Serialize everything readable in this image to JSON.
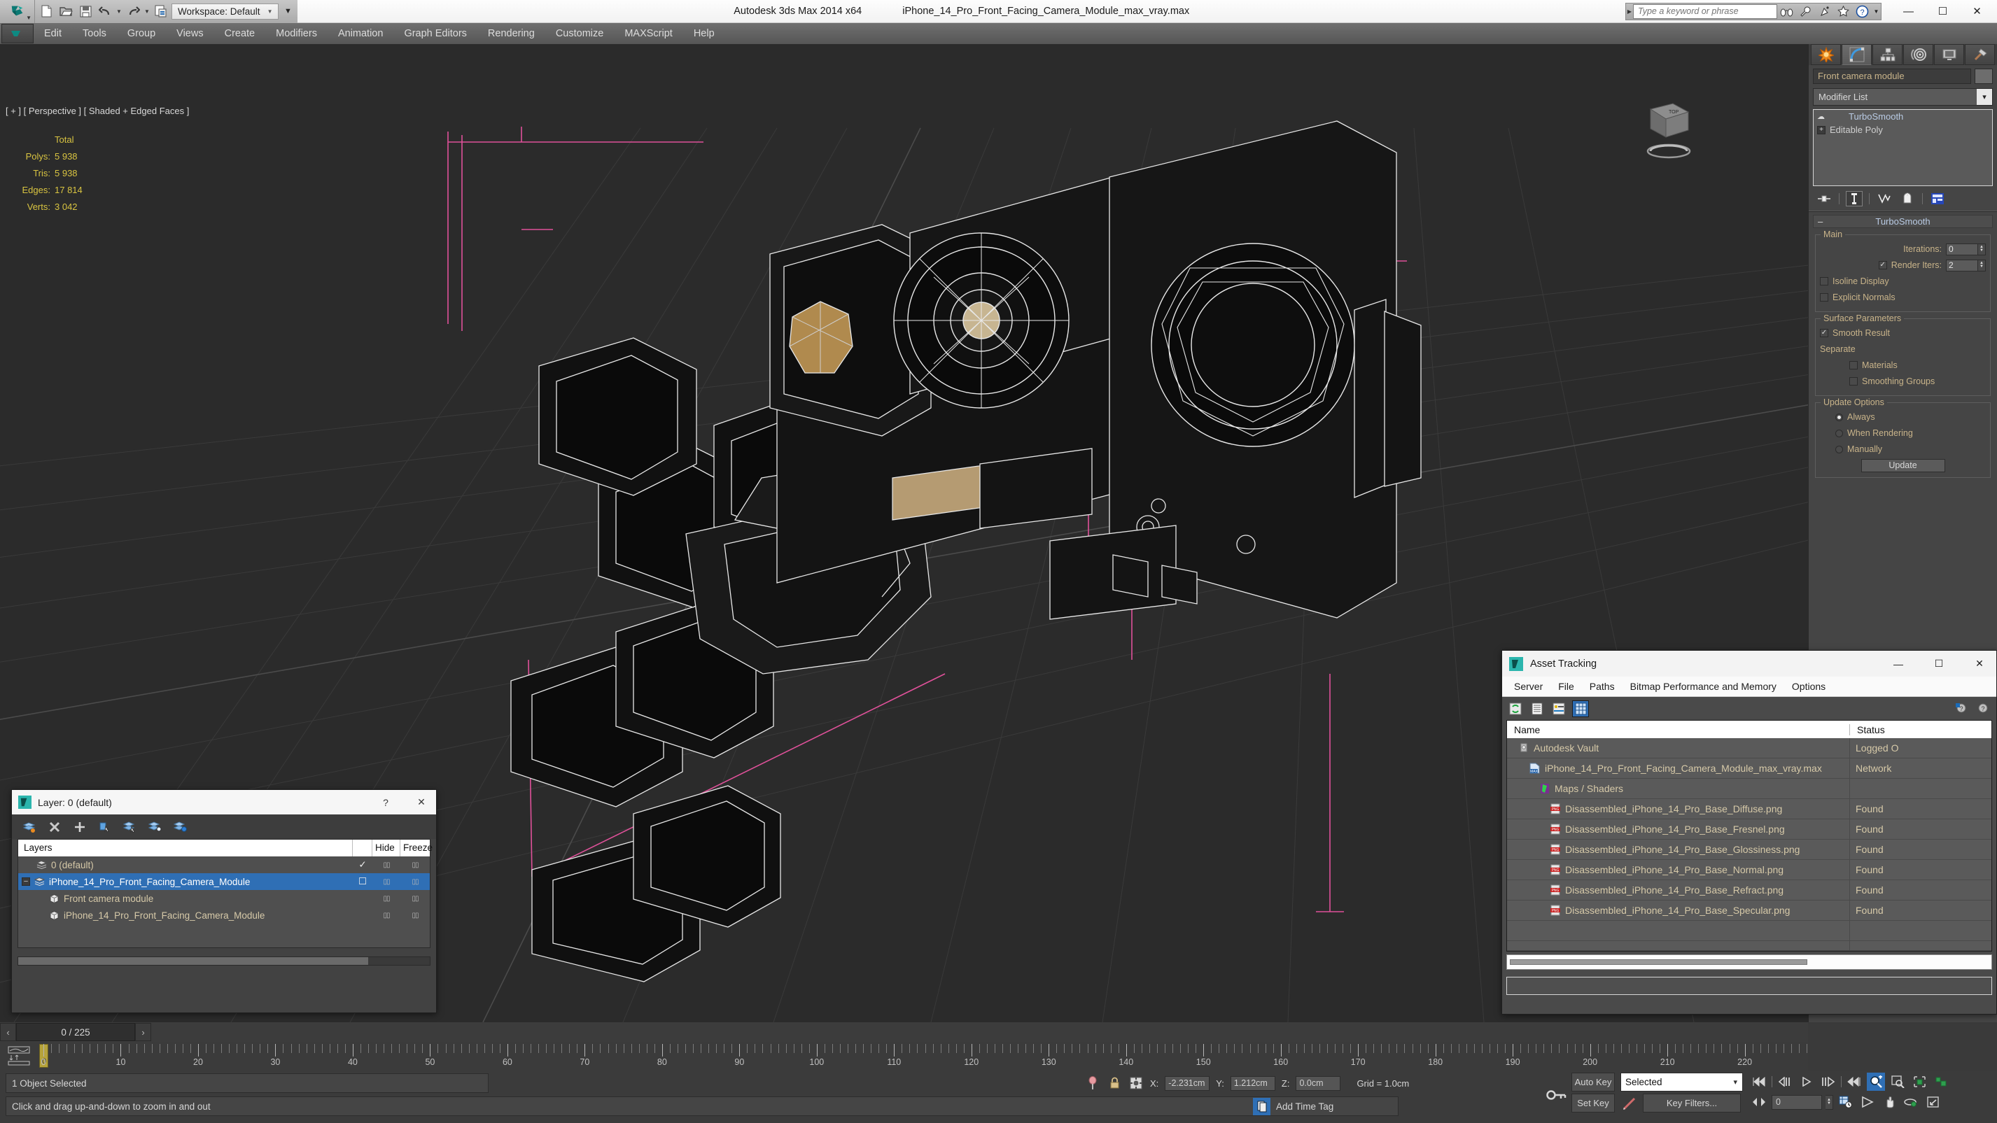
{
  "titlebar": {
    "workspace": "Workspace: Default",
    "app_title": "Autodesk 3ds Max  2014 x64",
    "file_title": "iPhone_14_Pro_Front_Facing_Camera_Module_max_vray.max",
    "search_placeholder": "Type a keyword or phrase",
    "quick_icons": [
      "new-file-icon",
      "open-file-icon",
      "save-icon",
      "undo-icon",
      "undo-dropdown-icon",
      "redo-icon",
      "redo-dropdown-icon",
      "set-project-folder-icon"
    ],
    "search_icons": [
      "binoculars-icon",
      "wrench-icon",
      "satellite-icon",
      "star-icon",
      "help-icon",
      "help-dropdown-icon"
    ],
    "window_buttons": [
      "minimize",
      "restore",
      "close"
    ]
  },
  "menubar": {
    "items": [
      "Edit",
      "Tools",
      "Group",
      "Views",
      "Create",
      "Modifiers",
      "Animation",
      "Graph Editors",
      "Rendering",
      "Customize",
      "MAXScript",
      "Help"
    ]
  },
  "viewport": {
    "label": "[ + ] [ Perspective ] [ Shaded + Edged Faces ]",
    "stats_header": "Total",
    "stats": [
      {
        "label": "Polys:",
        "value": "5 938"
      },
      {
        "label": "Tris:",
        "value": "5 938"
      },
      {
        "label": "Edges:",
        "value": "17 814"
      },
      {
        "label": "Verts:",
        "value": "3 042"
      }
    ],
    "stats_color": "#d9c441",
    "bg_color": "#2b2b2b",
    "viewcube_label": "TOP"
  },
  "command_panel": {
    "tabs": [
      "create-tab",
      "modify-tab",
      "hierarchy-tab",
      "motion-tab",
      "display-tab",
      "utilities-tab"
    ],
    "active_tab_index": 1,
    "object_name": "Front camera module",
    "modifier_list_label": "Modifier List",
    "stack": [
      {
        "label": "TurboSmooth",
        "selected": true
      },
      {
        "label": "Editable Poly",
        "selected": false
      }
    ],
    "stack_buttons": [
      "pin-stack-icon",
      "show-end-result-icon",
      "make-unique-icon",
      "remove-modifier-icon",
      "configure-modifier-sets-icon"
    ],
    "rollout": {
      "title": "TurboSmooth",
      "groups": [
        {
          "title": "Main",
          "fields": [
            {
              "type": "spinner",
              "label": "Iterations:",
              "value": "0",
              "checkbox": null
            },
            {
              "type": "spinner",
              "label": "Render Iters:",
              "value": "2",
              "checkbox": true
            },
            {
              "type": "checkbox",
              "label": "Isoline Display",
              "checked": false
            },
            {
              "type": "checkbox",
              "label": "Explicit Normals",
              "checked": false
            }
          ]
        },
        {
          "title": "Surface Parameters",
          "fields": [
            {
              "type": "checkbox",
              "label": "Smooth Result",
              "checked": true
            },
            {
              "type": "text",
              "label": "Separate"
            },
            {
              "type": "checkbox",
              "label": "Materials",
              "checked": false,
              "indent": true
            },
            {
              "type": "checkbox",
              "label": "Smoothing Groups",
              "checked": false,
              "indent": true
            }
          ]
        },
        {
          "title": "Update Options",
          "fields": [
            {
              "type": "radio",
              "label": "Always",
              "checked": true
            },
            {
              "type": "radio",
              "label": "When Rendering",
              "checked": false
            },
            {
              "type": "radio",
              "label": "Manually",
              "checked": false
            },
            {
              "type": "button",
              "label": "Update"
            }
          ]
        }
      ]
    }
  },
  "asset_tracking": {
    "title": "Asset Tracking",
    "menu": [
      "Server",
      "File",
      "Paths",
      "Bitmap Performance and Memory",
      "Options"
    ],
    "toolbar_icons": [
      "refresh-icon",
      "list-view-icon",
      "details-view-icon",
      "grid-view-icon"
    ],
    "toolbar_right_icons": [
      "help-add-icon",
      "help-icon"
    ],
    "columns": [
      "Name",
      "Status"
    ],
    "rows": [
      {
        "name": "Autodesk Vault",
        "status": "Logged O",
        "icon": "vault-icon",
        "indent": 0
      },
      {
        "name": "iPhone_14_Pro_Front_Facing_Camera_Module_max_vray.max",
        "status": "Network ",
        "icon": "max-file-icon",
        "indent": 1
      },
      {
        "name": "Maps / Shaders",
        "status": "",
        "icon": "maps-icon",
        "indent": 2
      },
      {
        "name": "Disassembled_iPhone_14_Pro_Base_Diffuse.png",
        "status": "Found",
        "icon": "png-icon",
        "indent": 3
      },
      {
        "name": "Disassembled_iPhone_14_Pro_Base_Fresnel.png",
        "status": "Found",
        "icon": "png-icon",
        "indent": 3
      },
      {
        "name": "Disassembled_iPhone_14_Pro_Base_Glossiness.png",
        "status": "Found",
        "icon": "png-icon",
        "indent": 3
      },
      {
        "name": "Disassembled_iPhone_14_Pro_Base_Normal.png",
        "status": "Found",
        "icon": "png-icon",
        "indent": 3
      },
      {
        "name": "Disassembled_iPhone_14_Pro_Base_Refract.png",
        "status": "Found",
        "icon": "png-icon",
        "indent": 3
      },
      {
        "name": "Disassembled_iPhone_14_Pro_Base_Specular.png",
        "status": "Found",
        "icon": "png-icon",
        "indent": 3
      },
      {
        "name": "",
        "status": "",
        "icon": "",
        "indent": 0
      },
      {
        "name": "",
        "status": "",
        "icon": "",
        "indent": 0
      }
    ]
  },
  "layer_dialog": {
    "title": "Layer: 0 (default)",
    "toolbar_icons": [
      "create-new-layer-icon",
      "delete-layer-icon",
      "add-selection-icon",
      "select-objects-icon",
      "select-highlighted-icon",
      "set-current-layer-icon",
      "layer-properties-icon"
    ],
    "columns": [
      "Layers",
      "",
      "Hide",
      "Freeze"
    ],
    "rows": [
      {
        "name": "0 (default)",
        "current": "✓",
        "hide": "",
        "freeze": "",
        "selected": false,
        "expander": "",
        "icon": "layer-icon",
        "indent": 1
      },
      {
        "name": "iPhone_14_Pro_Front_Facing_Camera_Module",
        "current": "box",
        "hide": "",
        "freeze": "",
        "selected": true,
        "expander": "-",
        "icon": "layer-icon",
        "indent": 0
      },
      {
        "name": "Front camera module",
        "current": "",
        "hide": "",
        "freeze": "",
        "selected": false,
        "expander": "",
        "icon": "object-icon",
        "indent": 2
      },
      {
        "name": "iPhone_14_Pro_Front_Facing_Camera_Module",
        "current": "",
        "hide": "",
        "freeze": "",
        "selected": false,
        "expander": "",
        "icon": "object-icon",
        "indent": 2
      }
    ]
  },
  "timeline": {
    "current_frame_label": "0 / 225",
    "prev_icon": "‹",
    "next_icon": "›",
    "ticks": [
      0,
      10,
      20,
      30,
      40,
      50,
      60,
      70,
      80,
      90,
      100,
      110,
      120,
      130,
      140,
      150,
      160,
      170,
      180,
      190,
      200,
      210,
      220
    ],
    "playhead_frame": 0,
    "total_frames": 225
  },
  "statusbar": {
    "selection_text": "1 Object Selected",
    "prompt_text": "Click and drag up-and-down to zoom in and out",
    "coords": [
      {
        "axis": "X:",
        "value": "-2.231cm"
      },
      {
        "axis": "Y:",
        "value": "1.212cm"
      },
      {
        "axis": "Z:",
        "value": "0.0cm"
      }
    ],
    "grid_label": "Grid = 1.0cm",
    "add_time_tag": "Add Time Tag",
    "auto_key": "Auto Key",
    "set_key": "Set Key",
    "key_filters": "Key Filters...",
    "selection_set": "Selected",
    "frame_field": "0",
    "icons": [
      "pin-icon",
      "lock-selection-icon",
      "absolute-mode-icon",
      "key-mode-icon",
      "time-tag-icon"
    ],
    "playback_icons": [
      "goto-start-icon",
      "prev-frame-icon",
      "play-icon",
      "next-frame-icon",
      "goto-end-icon",
      "zoom-time-icon",
      "time-config-icon"
    ],
    "nav_icons": [
      "zoom-icon",
      "zoom-all-icon",
      "zoom-extents-icon",
      "zoom-region-icon",
      "field-of-view-icon",
      "pan-icon",
      "orbit-icon",
      "maximize-viewport-icon"
    ]
  }
}
